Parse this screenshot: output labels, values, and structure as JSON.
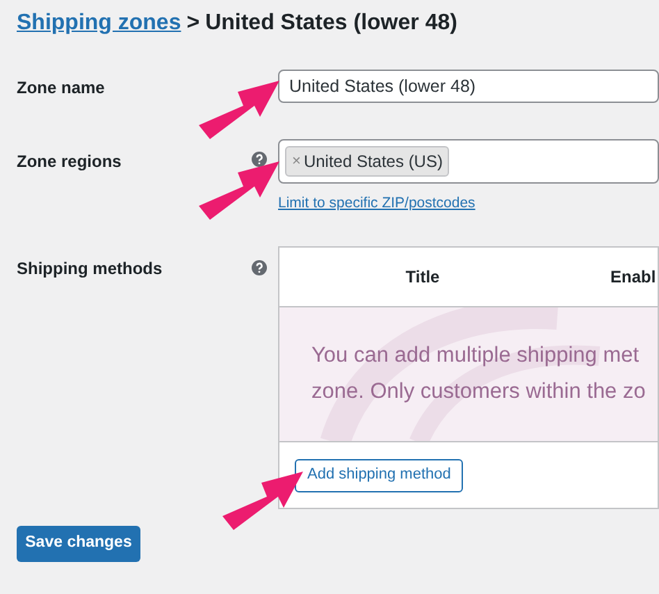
{
  "breadcrumb": {
    "link": "Shipping zones",
    "separator": ">",
    "current": "United States (lower 48)"
  },
  "zone_name": {
    "label": "Zone name",
    "value": "United States (lower 48)"
  },
  "zone_regions": {
    "label": "Zone regions",
    "tags": [
      "United States (US)"
    ],
    "remove_symbol": "×",
    "link": "Limit to specific ZIP/postcodes"
  },
  "shipping_methods": {
    "label": "Shipping methods",
    "columns": [
      "Title",
      "Enabl"
    ],
    "empty_message": [
      "You can add multiple shipping met",
      "zone. Only customers within the zo"
    ],
    "add_button": "Add shipping method"
  },
  "save_button": "Save changes"
}
